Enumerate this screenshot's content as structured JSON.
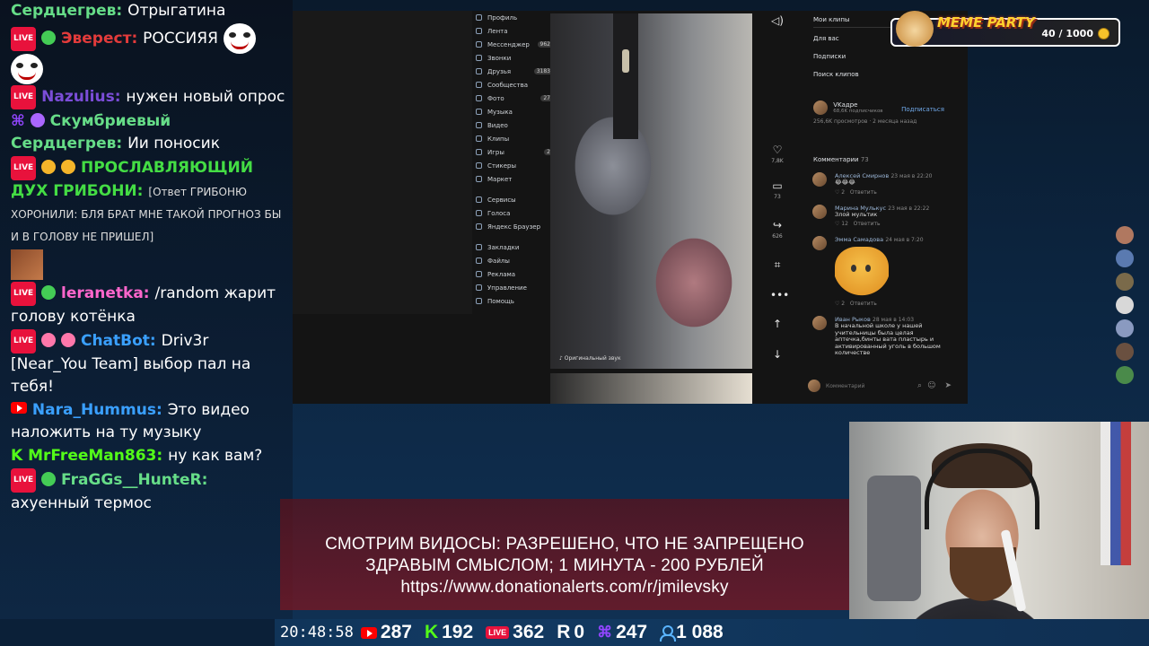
{
  "chat": [
    {
      "id": "m0",
      "badges": [],
      "name": "Сердцегрев:",
      "name_color": "#66dd88",
      "text": "Отрыгатина"
    },
    {
      "id": "m1",
      "badges": [
        "live",
        "emoji"
      ],
      "name": "Эверест:",
      "name_color": "#e33b3b",
      "text": "РОССИЯЯ"
    },
    {
      "id": "m2",
      "badges": [
        "live"
      ],
      "name": "Nazulius:",
      "name_color": "#7b4dd8",
      "text": "нужен новый опрос"
    },
    {
      "id": "m3",
      "badges": [
        "twitch",
        "emoji"
      ],
      "name": "Скумбриевый Сердцегрев:",
      "name_color": "#66dd88",
      "text": "Ии поносик"
    },
    {
      "id": "m4",
      "badges": [
        "live",
        "emoji",
        "emoji"
      ],
      "name": "ПРОСЛАВЛЯЮЩИЙ ДУХ ГРИБОНИ:",
      "name_color": "#44dd44",
      "text": "[Ответ ГРИБОНЮ ХОРОНИЛИ: БЛЯ БРАТ МНЕ ТАКОЙ ПРОГНОЗ БЫ И В ГОЛОВУ НЕ ПРИШЕЛ]"
    },
    {
      "id": "m5",
      "badges": [
        "live",
        "emoji"
      ],
      "name": "leranetka:",
      "name_color": "#ff66cc",
      "text": "/random жарит  голову котёнка"
    },
    {
      "id": "m6",
      "badges": [
        "live",
        "emoji",
        "emoji"
      ],
      "name": "ChatBot:",
      "name_color": "#3aa0ff",
      "text": "Driv3r [Near_You Team] выбор пал на тебя!"
    },
    {
      "id": "m7",
      "badges": [
        "youtube"
      ],
      "name": "Nara_Hummus:",
      "name_color": "#3aa0ff",
      "text": "Это видео наложить на ту музыку"
    },
    {
      "id": "m8",
      "badges": [
        "kick"
      ],
      "name": "MrFreeMan863:",
      "name_color": "#53fc18",
      "text": "ну как вам?"
    },
    {
      "id": "m9",
      "badges": [
        "live",
        "emoji"
      ],
      "name": "FraGGs__HunteR:",
      "name_color": "#66dd88",
      "text": "ахуенный термос"
    }
  ],
  "vk": {
    "menu": [
      {
        "label": "Профиль"
      },
      {
        "label": "Лента"
      },
      {
        "label": "Мессенджер",
        "count": "962"
      },
      {
        "label": "Звонки"
      },
      {
        "label": "Друзья",
        "count": "3183"
      },
      {
        "label": "Сообщества"
      },
      {
        "label": "Фото",
        "count": "27"
      },
      {
        "label": "Музыка"
      },
      {
        "label": "Видео"
      },
      {
        "label": "Клипы"
      },
      {
        "label": "Игры",
        "count": "2"
      },
      {
        "label": "Стикеры"
      },
      {
        "label": "Маркет"
      }
    ],
    "menu2": [
      {
        "label": "Сервисы"
      },
      {
        "label": "Голоса"
      },
      {
        "label": "Яндекс Браузер"
      }
    ],
    "menu3": [
      {
        "label": "Закладки"
      },
      {
        "label": "Файлы"
      },
      {
        "label": "Реклама"
      },
      {
        "label": "Управление"
      },
      {
        "label": "Помощь"
      }
    ],
    "video_caption": "Оригинальный звук",
    "actions": [
      {
        "name": "like",
        "glyph": "♡",
        "count": "7,8K"
      },
      {
        "name": "comment",
        "glyph": "▭",
        "count": "73"
      },
      {
        "name": "share",
        "glyph": "↪",
        "count": "626"
      },
      {
        "name": "dislike",
        "glyph": "⌗",
        "count": ""
      },
      {
        "name": "more",
        "glyph": "•••",
        "count": ""
      }
    ],
    "right_links": [
      "Мои клипы",
      "Для вас",
      "Подписки",
      "Поиск клипов"
    ],
    "channel": {
      "name": "VKадре",
      "subs": "68,6K подписчиков",
      "subscribe": "Подписаться",
      "stats": "256,6K просмотров · 2 месяца назад"
    },
    "comments_title": "Комментарии",
    "comments_count": "73",
    "comments": [
      {
        "author": "Алексей Смирнов",
        "when": "23 мая в 22:20",
        "body": "😂😂😂",
        "likes": "2",
        "reply": "Ответить"
      },
      {
        "author": "Марина Мулькус",
        "when": "23 мая в 22:22",
        "body": "Злой мультик",
        "likes": "12",
        "reply": "Ответить"
      },
      {
        "author": "Эмма Самадова",
        "when": "24 мая в 7:20",
        "body": "",
        "likes": "2",
        "reply": "Ответить",
        "sticker": true
      },
      {
        "author": "Иван Рыков",
        "when": "28 мая в 14:03",
        "body": "В начальной школе у нашей учительницы была целая аптечка,бинты вата пластырь и активированный уголь в большом количестве",
        "likes": "",
        "reply": ""
      }
    ],
    "comment_placeholder": "Комментарий"
  },
  "meme": {
    "title": "MEME PARTY",
    "count": "40 / 1000"
  },
  "banner": {
    "line1": "СМОТРИМ ВИДОСЫ: РАЗРЕШЕНО, ЧТО НЕ ЗАПРЕЩЕНО",
    "line2": "ЗДРАВЫМ СМЫСЛОМ; 1 МИНУТА - 200 РУБЛЕЙ",
    "line3": "https://www.donationalerts.com/r/jmilevsky"
  },
  "stats": {
    "time": "20:48:58",
    "youtube": "287",
    "kick": "192",
    "vklive": "362",
    "rutube": "0",
    "twitch": "247",
    "viewers": "1 088"
  },
  "colors": {
    "accent_red": "#e8123c",
    "kick_green": "#53fc18",
    "twitch_purple": "#9146ff",
    "vk_link": "#9db8d9"
  }
}
